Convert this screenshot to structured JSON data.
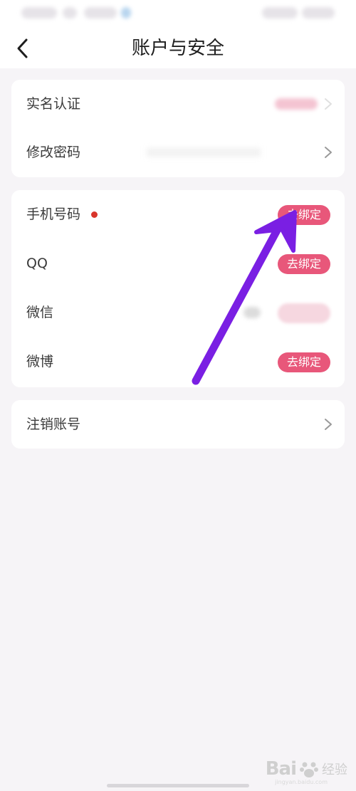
{
  "nav": {
    "title": "账户与安全",
    "back_icon": "chevron-left-icon"
  },
  "section1": {
    "items": [
      {
        "label": "实名认证",
        "status": "blurred",
        "icon": "chevron-right-icon"
      },
      {
        "label": "修改密码",
        "icon": "chevron-right-icon"
      }
    ]
  },
  "section2": {
    "items": [
      {
        "label": "手机号码",
        "badge": "red-dot",
        "action": "去绑定"
      },
      {
        "label": "QQ",
        "action": "去绑定"
      },
      {
        "label": "微信",
        "status": "blurred"
      },
      {
        "label": "微博",
        "action": "去绑定"
      }
    ]
  },
  "section3": {
    "items": [
      {
        "label": "注销账号",
        "icon": "chevron-right-icon"
      }
    ]
  },
  "overlay": {
    "annotation": "purple-arrow"
  },
  "watermark": {
    "name": "Bai",
    "text": "经验",
    "sub": "jingyan.baidu.com"
  },
  "colors": {
    "background": "#f6f4f7",
    "card": "#ffffff",
    "accent": "#e8577a",
    "red_dot": "#d9352b",
    "arrow": "#7a1fe3"
  }
}
